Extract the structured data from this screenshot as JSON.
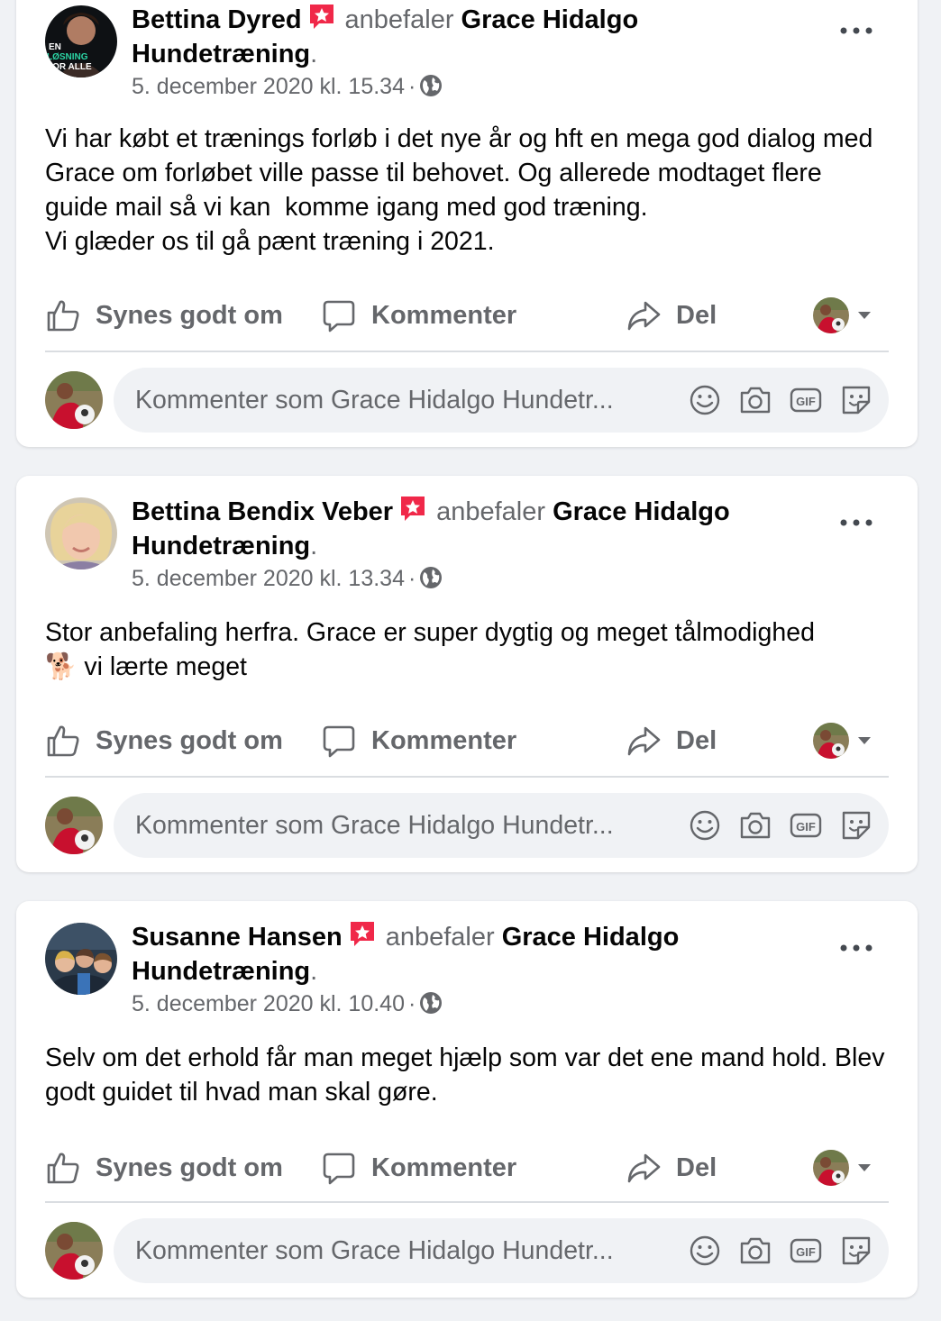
{
  "posts": [
    {
      "author": "Bettina Dyred",
      "verb": "anbefaler",
      "page": "Grace Hidalgo Hundetræning",
      "dot": ".",
      "timestamp": "5. december 2020 kl. 15.34",
      "separator": "·",
      "avatar_text": [
        "EN",
        "LØSNING",
        "FOR ALLE"
      ],
      "body": "Vi har købt et trænings forløb i det nye år og hft en mega god dialog med Grace om forløbet ville passe til behovet. Og allerede modtaget flere guide mail så vi kan  komme igang med god træning.\nVi glæder os til gå pænt træning i 2021."
    },
    {
      "author": "Bettina Bendix Veber",
      "verb": "anbefaler",
      "page": "Grace Hidalgo Hundetræning",
      "dot": ".",
      "timestamp": "5. december 2020 kl. 13.34",
      "separator": "·",
      "body": "Stor anbefaling herfra. Grace er super dygtig og meget tålmodighed\n🐕 vi lærte meget"
    },
    {
      "author": "Susanne Hansen",
      "verb": "anbefaler",
      "page": "Grace Hidalgo Hundetræning",
      "dot": ".",
      "timestamp": "5. december 2020 kl. 10.40",
      "separator": "·",
      "body": "Selv om det erhold får man meget hjælp som var det ene mand hold. Blev godt guidet til hvad man skal gøre."
    }
  ],
  "actions": {
    "like": "Synes godt om",
    "comment": "Kommenter",
    "share": "Del"
  },
  "comment_placeholder": "Kommenter som Grace Hidalgo Hundetr...",
  "icons": {
    "recommend_badge": "star-badge-icon",
    "privacy": "globe-icon",
    "more": "more-icon",
    "like": "thumbs-up-icon",
    "comment": "comment-bubble-icon",
    "share": "share-arrow-icon",
    "emoji": "smiley-icon",
    "photo": "camera-icon",
    "gif": "gif-icon",
    "sticker": "sticker-icon"
  },
  "colors": {
    "badge": "#f02849",
    "secondary_text": "#65676b",
    "background": "#f0f2f5"
  }
}
